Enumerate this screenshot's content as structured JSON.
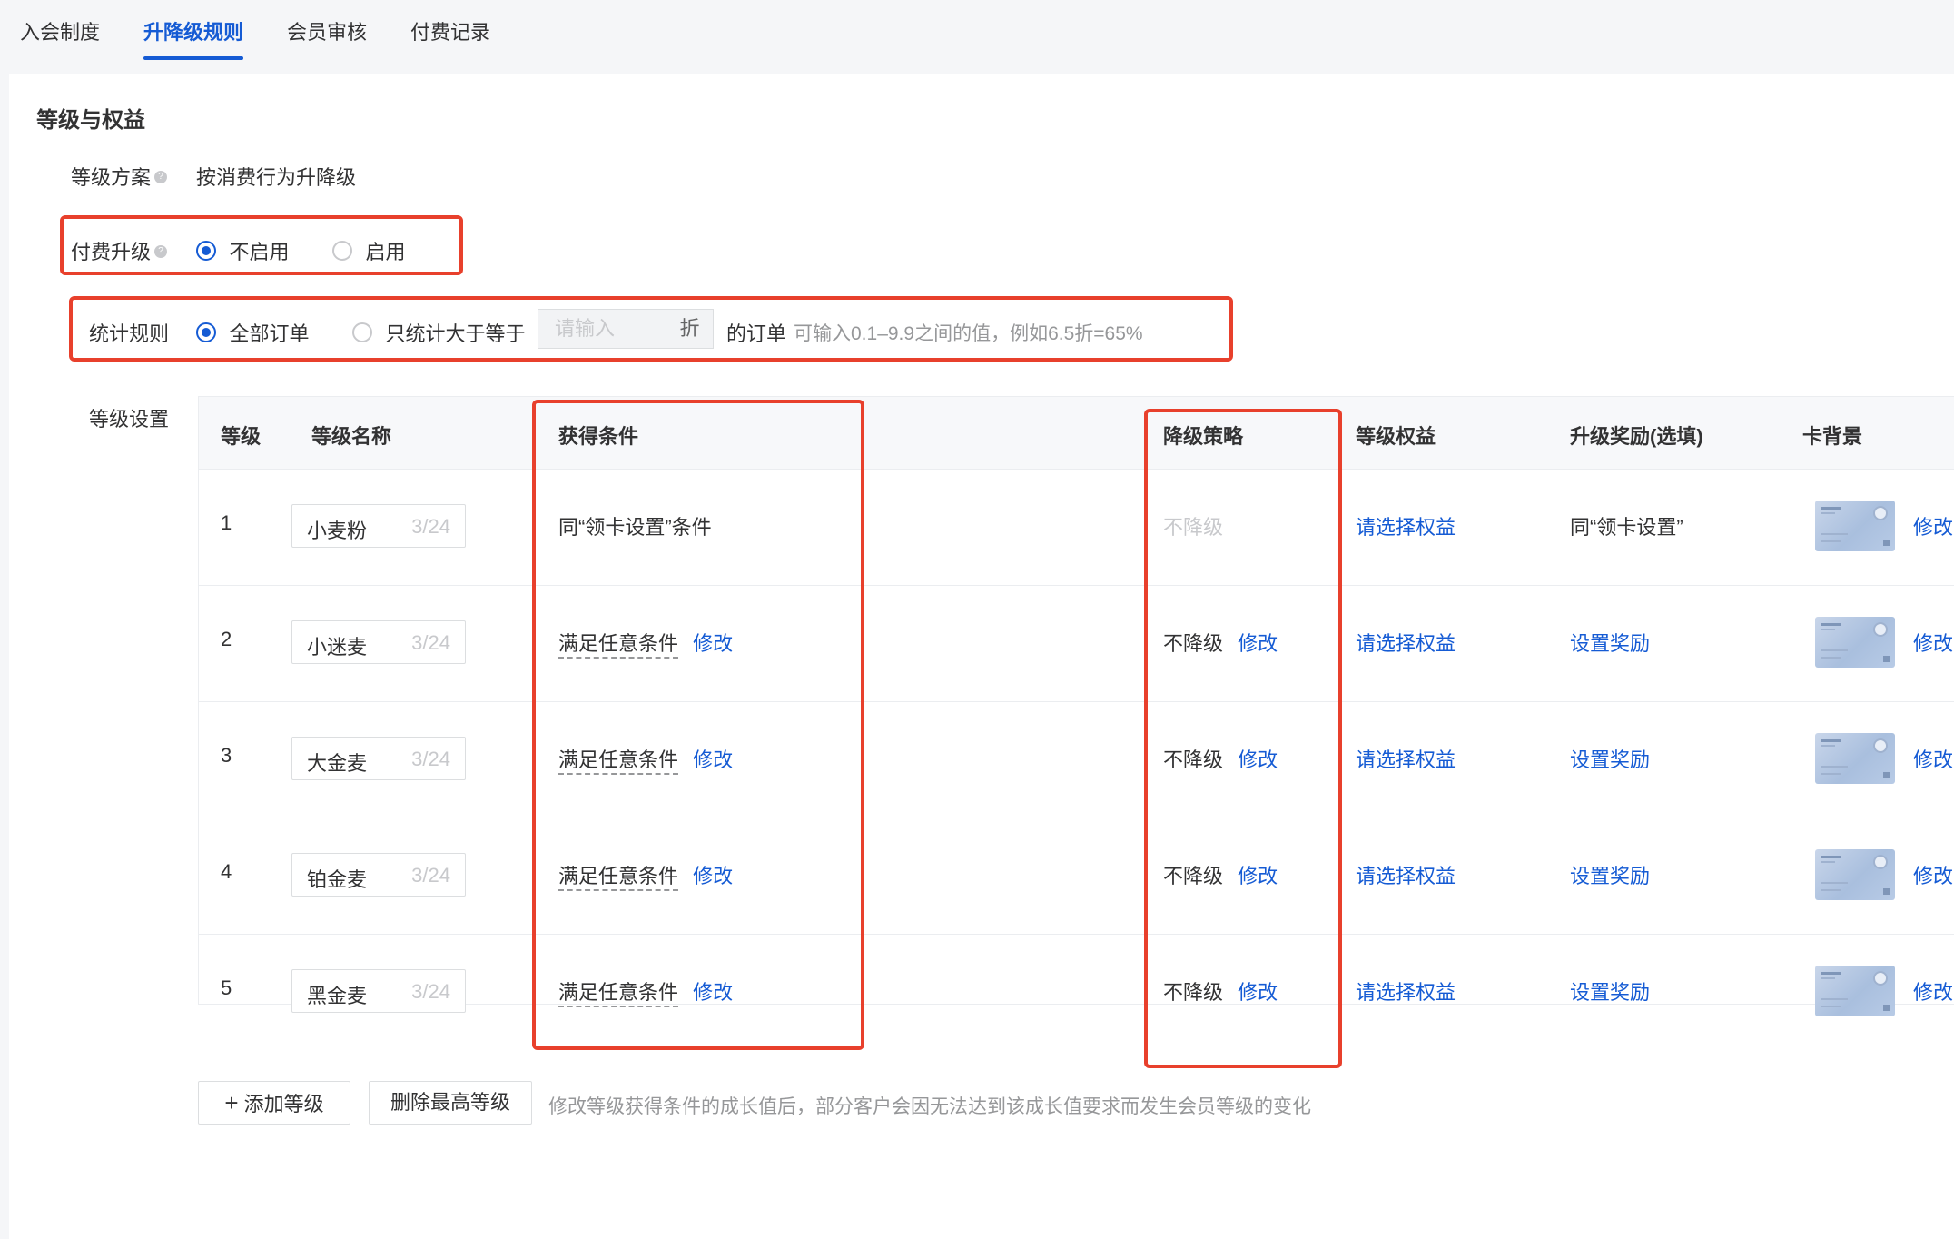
{
  "tabs": [
    {
      "label": "入会制度",
      "active": false
    },
    {
      "label": "升降级规则",
      "active": true
    },
    {
      "label": "会员审核",
      "active": false
    },
    {
      "label": "付费记录",
      "active": false
    }
  ],
  "section_title": "等级与权益",
  "level_scheme": {
    "label": "等级方案",
    "value": "按消费行为升降级"
  },
  "paid_upgrade": {
    "label": "付费升级",
    "options": [
      "不启用",
      "启用"
    ],
    "selected": "不启用"
  },
  "stat_rule": {
    "label": "统计规则",
    "option_all": "全部订单",
    "option_partial": "只统计大于等于",
    "selected": "全部订单",
    "input_placeholder": "请输入",
    "addon": "折",
    "suffix": "的订单",
    "hint": "可输入0.1–9.9之间的值，例如6.5折=65%"
  },
  "level_settings": {
    "label": "等级设置",
    "columns": [
      "等级",
      "等级名称",
      "获得条件",
      "降级策略",
      "等级权益",
      "升级奖励(选填)",
      "卡背景"
    ],
    "rows": [
      {
        "level": "1",
        "name": "小麦粉",
        "count": "3/24",
        "condition": "同“领卡设置”条件",
        "downgrade": "不降级",
        "benefit": "请选择权益",
        "reward": "同“领卡设置”",
        "edit": "修改"
      },
      {
        "level": "2",
        "name": "小迷麦",
        "count": "3/24",
        "condition": "满足任意条件",
        "condition_edit": "修改",
        "downgrade": "不降级",
        "downgrade_edit": "修改",
        "benefit": "请选择权益",
        "reward": "设置奖励",
        "edit": "修改"
      },
      {
        "level": "3",
        "name": "大金麦",
        "count": "3/24",
        "condition": "满足任意条件",
        "condition_edit": "修改",
        "downgrade": "不降级",
        "downgrade_edit": "修改",
        "benefit": "请选择权益",
        "reward": "设置奖励",
        "edit": "修改"
      },
      {
        "level": "4",
        "name": "铂金麦",
        "count": "3/24",
        "condition": "满足任意条件",
        "condition_edit": "修改",
        "downgrade": "不降级",
        "downgrade_edit": "修改",
        "benefit": "请选择权益",
        "reward": "设置奖励",
        "edit": "修改"
      },
      {
        "level": "5",
        "name": "黑金麦",
        "count": "3/24",
        "condition": "满足任意条件",
        "condition_edit": "修改",
        "downgrade": "不降级",
        "downgrade_edit": "修改",
        "benefit": "请选择权益",
        "reward": "设置奖励",
        "edit": "修改"
      }
    ]
  },
  "actions": {
    "add_level": "添加等级",
    "delete_top_level": "删除最高等级",
    "hint": "修改等级获得条件的成长值后，部分客户会因无法达到该成长值要求而发生会员等级的变化"
  },
  "colors": {
    "accent": "#155bd4",
    "highlight_box": "#e8402c"
  }
}
